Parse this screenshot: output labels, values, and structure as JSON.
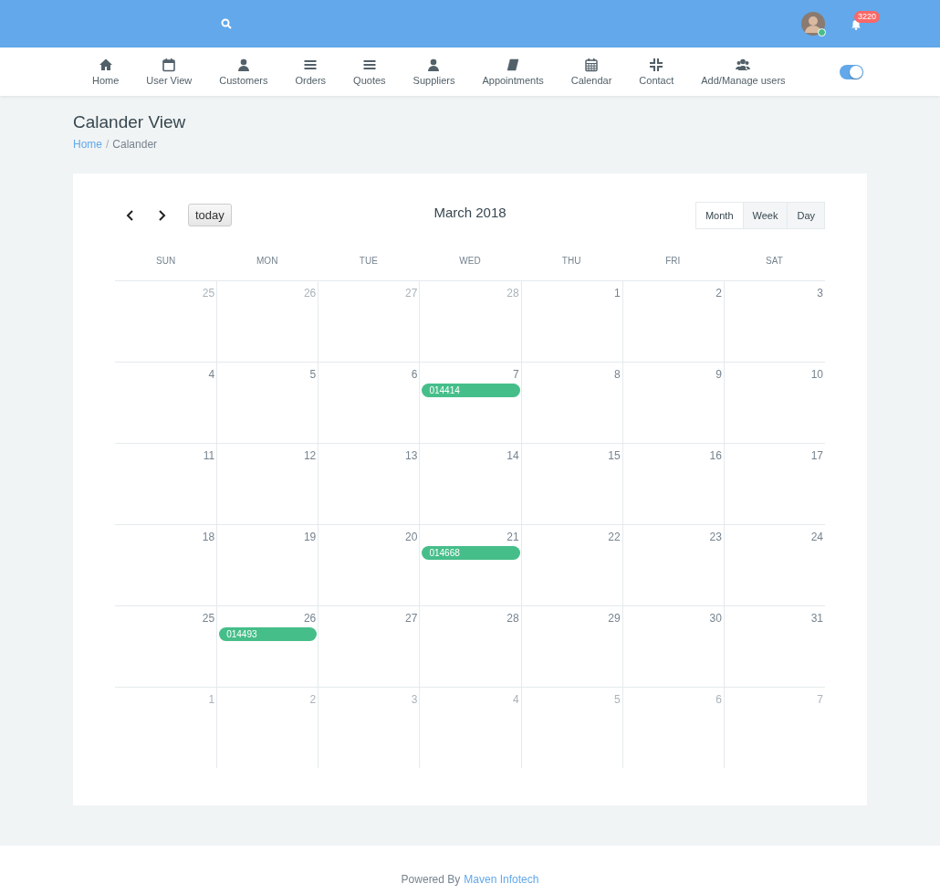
{
  "topbar": {
    "notification_count": "3220",
    "avatar": {
      "online": true
    }
  },
  "nav": [
    {
      "label": "Home",
      "kind": "home"
    },
    {
      "label": "User View",
      "kind": "calendar-blank"
    },
    {
      "label": "Customers",
      "kind": "user"
    },
    {
      "label": "Orders",
      "kind": "bars"
    },
    {
      "label": "Quotes",
      "kind": "bars"
    },
    {
      "label": "Suppliers",
      "kind": "user"
    },
    {
      "label": "Appointments",
      "kind": "book"
    },
    {
      "label": "Calendar",
      "kind": "calendar-grid"
    },
    {
      "label": "Contact",
      "kind": "compress"
    },
    {
      "label": "Add/Manage users",
      "kind": "users"
    }
  ],
  "toggle": {
    "on": true
  },
  "page": {
    "title": "Calander View",
    "breadcrumb": [
      "Home",
      "Calander"
    ],
    "breadcrumb_separator": "/"
  },
  "calendar": {
    "title": "March 2018",
    "today_button": "today",
    "views": [
      {
        "label": "Month",
        "selected": true
      },
      {
        "label": "Week",
        "selected": false
      },
      {
        "label": "Day",
        "selected": false
      }
    ],
    "weekdays": [
      "SUN",
      "MON",
      "TUE",
      "WED",
      "THU",
      "FRI",
      "SAT"
    ],
    "weeks": [
      [
        {
          "day": "25",
          "outside": true
        },
        {
          "day": "26",
          "outside": true
        },
        {
          "day": "27",
          "outside": true
        },
        {
          "day": "28",
          "outside": true
        },
        {
          "day": "1",
          "outside": false
        },
        {
          "day": "2",
          "outside": false
        },
        {
          "day": "3",
          "outside": false
        }
      ],
      [
        {
          "day": "4",
          "outside": false
        },
        {
          "day": "5",
          "outside": false
        },
        {
          "day": "6",
          "outside": false
        },
        {
          "day": "7",
          "outside": false,
          "events": [
            "014414"
          ]
        },
        {
          "day": "8",
          "outside": false
        },
        {
          "day": "9",
          "outside": false
        },
        {
          "day": "10",
          "outside": false
        }
      ],
      [
        {
          "day": "11",
          "outside": false
        },
        {
          "day": "12",
          "outside": false
        },
        {
          "day": "13",
          "outside": false
        },
        {
          "day": "14",
          "outside": false
        },
        {
          "day": "15",
          "outside": false
        },
        {
          "day": "16",
          "outside": false
        },
        {
          "day": "17",
          "outside": false
        }
      ],
      [
        {
          "day": "18",
          "outside": false
        },
        {
          "day": "19",
          "outside": false
        },
        {
          "day": "20",
          "outside": false
        },
        {
          "day": "21",
          "outside": false,
          "events": [
            "014668"
          ]
        },
        {
          "day": "22",
          "outside": false
        },
        {
          "day": "23",
          "outside": false
        },
        {
          "day": "24",
          "outside": false
        }
      ],
      [
        {
          "day": "25",
          "outside": false
        },
        {
          "day": "26",
          "outside": false,
          "events": [
            "014493"
          ]
        },
        {
          "day": "27",
          "outside": false
        },
        {
          "day": "28",
          "outside": false
        },
        {
          "day": "29",
          "outside": false
        },
        {
          "day": "30",
          "outside": false
        },
        {
          "day": "31",
          "outside": false
        }
      ],
      [
        {
          "day": "1",
          "outside": true
        },
        {
          "day": "2",
          "outside": true
        },
        {
          "day": "3",
          "outside": true
        },
        {
          "day": "4",
          "outside": true
        },
        {
          "day": "5",
          "outside": true
        },
        {
          "day": "6",
          "outside": true
        },
        {
          "day": "7",
          "outside": true
        }
      ]
    ]
  },
  "footer": {
    "text": "Powered By",
    "link": "Maven Infotech"
  }
}
